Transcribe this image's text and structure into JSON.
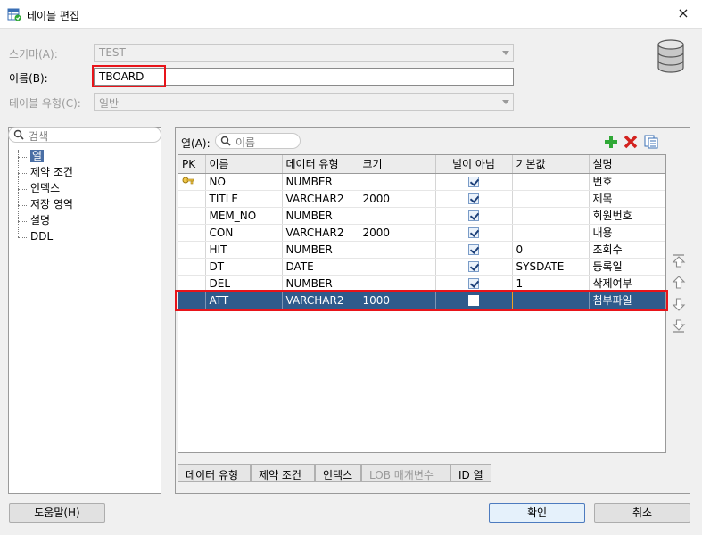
{
  "window": {
    "title": "테이블 편집",
    "close_glyph": "×"
  },
  "form": {
    "schema_label": "스키마(A):",
    "schema_value": "TEST",
    "name_label": "이름(B):",
    "name_value": "TBOARD",
    "type_label": "테이블 유형(C):",
    "type_value": "일반"
  },
  "left": {
    "search_placeholder": "검색",
    "tree": [
      {
        "label": "열",
        "selected": true
      },
      {
        "label": "제약 조건",
        "selected": false
      },
      {
        "label": "인덱스",
        "selected": false
      },
      {
        "label": "저장 영역",
        "selected": false
      },
      {
        "label": "설명",
        "selected": false
      },
      {
        "label": "DDL",
        "selected": false
      }
    ]
  },
  "columns_panel": {
    "label": "열(A):",
    "search_placeholder": "이름",
    "headers": [
      "PK",
      "이름",
      "데이터 유형",
      "크기",
      "널이 아님",
      "기본값",
      "설명"
    ],
    "rows": [
      {
        "pk": true,
        "name": "NO",
        "type": "NUMBER",
        "size": "",
        "not_null": true,
        "default": "",
        "comment": "번호"
      },
      {
        "pk": false,
        "name": "TITLE",
        "type": "VARCHAR2",
        "size": "2000",
        "not_null": true,
        "default": "",
        "comment": "제목"
      },
      {
        "pk": false,
        "name": "MEM_NO",
        "type": "NUMBER",
        "size": "",
        "not_null": true,
        "default": "",
        "comment": "회원번호"
      },
      {
        "pk": false,
        "name": "CON",
        "type": "VARCHAR2",
        "size": "2000",
        "not_null": true,
        "default": "",
        "comment": "내용"
      },
      {
        "pk": false,
        "name": "HIT",
        "type": "NUMBER",
        "size": "",
        "not_null": true,
        "default": "0",
        "comment": "조회수"
      },
      {
        "pk": false,
        "name": "DT",
        "type": "DATE",
        "size": "",
        "not_null": true,
        "default": "SYSDATE",
        "comment": "등록일"
      },
      {
        "pk": false,
        "name": "DEL",
        "type": "NUMBER",
        "size": "",
        "not_null": true,
        "default": "1",
        "comment": "삭제여부"
      },
      {
        "pk": false,
        "name": "ATT",
        "type": "VARCHAR2",
        "size": "1000",
        "not_null": false,
        "default": "",
        "comment": "첨부파일",
        "selected": true
      }
    ],
    "tabs": [
      "데이터 유형",
      "제약 조건",
      "인덱스",
      "LOB 매개변수",
      "ID 열"
    ]
  },
  "buttons": {
    "help": "도움말(H)",
    "ok": "확인",
    "cancel": "취소"
  },
  "colors": {
    "highlight_red": "#e8141a",
    "selection_blue": "#2f5b8c",
    "add_green": "#2fa836",
    "delete_red": "#d3221f"
  }
}
